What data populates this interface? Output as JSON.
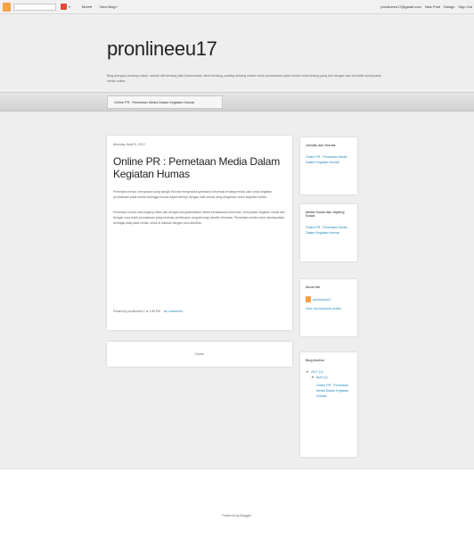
{
  "navbar": {
    "search_placeholder": "",
    "more_label": "More▾",
    "next_label": "Next Blog»",
    "right_links": [
      "pronlineeu17@gmail.com",
      "New Post",
      "Design",
      "Sign Out"
    ],
    "icons": [
      "blogger-logo-icon",
      "search-box",
      "gplus-icon",
      "chevron-down-icon"
    ]
  },
  "header": {
    "title": "pronlineeu17",
    "description": "Blog (dengan) tentang online, adalah alih tentang (lain) komunikasi, disini tentang, posting tentang materi untuk perusahaan pada media untuk bidang yang lain dengan dan di media sosial pada media online."
  },
  "tabs": [
    {
      "label": "Online PR : Pemetaan Media Dalam Kegiatan Humas"
    }
  ],
  "post": {
    "date": "Monday, April 9, 2017",
    "title": "Online PR : Pemetaan Media Dalam Kegiatan Humas",
    "paragraphs": [
      "Pemetaan media, merupakan yang sangat Humas mengetahui gambaran informasi tentang media, dan untuk kegiatan perusahaan pada media sehingga humas dapat bekerja dengan baik sesuai yang diinginkan untuk kegiatan media.",
      "Pemetaan media mencangkup disini dan dengan mengidentifikasi media berdasarkan informasi, merupakan kegiatan media dan dengan cara untuk perusahaan yang berbasis pembuatan program bagi pemilik informasi. Pemetaan media untuk mendapatkan berbagai data pada media, untuk di lakukan dengan cara aktivitas."
    ],
    "posted_by": "Posted by pronlineeu17 at 1:56 PM",
    "comments": "No comments:"
  },
  "home_link": "Home",
  "sidebar": {
    "widget1": {
      "title": "Jurnalis dan Humas",
      "link": "Online PR : Pemetaan Media Dalam Kegiatan Humas"
    },
    "widget2": {
      "title": "Media Sosial dan Jejaring Sosial",
      "link": "Online PR : Pemetaan Media Dalam Kegiatan Humas"
    },
    "about": {
      "title": "About Me",
      "name": "pronlineeu17",
      "profile_link": "View my complete profile"
    },
    "archive": {
      "title": "Blog Archive",
      "year": "2017 (1)",
      "month": "April (1)",
      "post": "Online PR : Pemetaan Media Dalam Kegiatan Humas"
    }
  },
  "footer": {
    "powered": "Powered by Blogger."
  },
  "colors": {
    "link": "#2288bb",
    "background": "#eeeeee",
    "card": "#ffffff"
  }
}
